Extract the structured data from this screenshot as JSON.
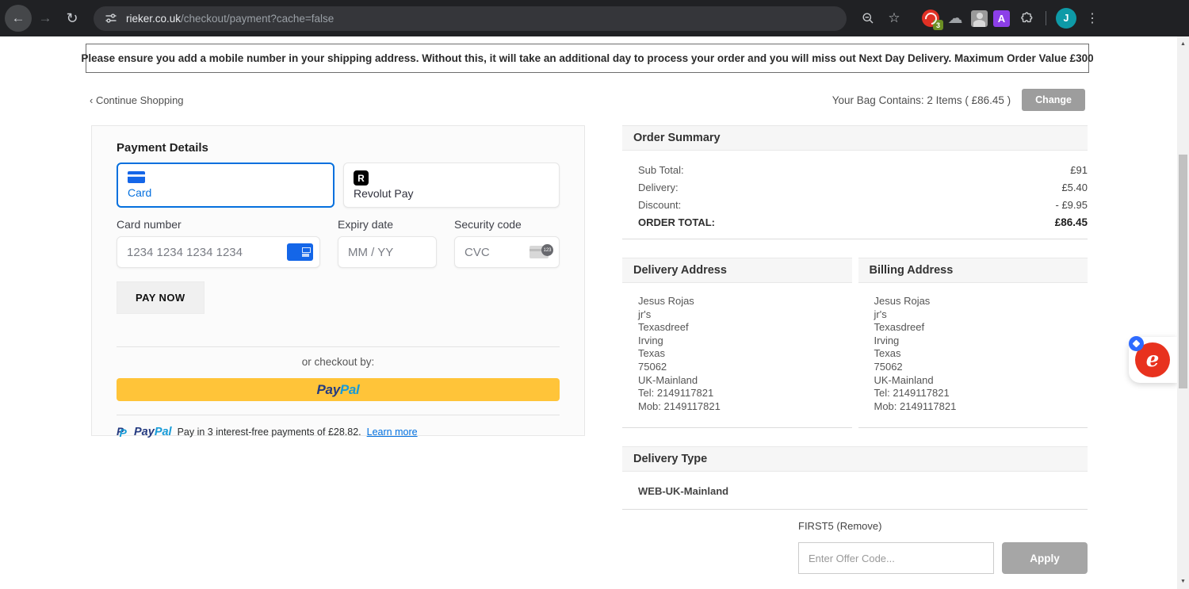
{
  "browser": {
    "url_domain": "rieker.co.uk",
    "url_path": "/checkout/payment?cache=false",
    "avatar_letter": "J",
    "ext_badge": "3",
    "ext_a_letter": "A"
  },
  "icons": {
    "back": "←",
    "forward": "→",
    "reload": "↻",
    "star": "☆",
    "overflow": "⋮",
    "cloud": "☁",
    "scroll_up": "▲",
    "scroll_down": "▼",
    "revolut": "R",
    "cvc_digits": "123",
    "monogram_p": "P",
    "coupon_logo": "e"
  },
  "banner": {
    "text": "Please ensure you add a mobile number in your shipping address. Without this, it will take an additional day to process your order and you will miss out Next Day Delivery. Maximum Order Value £300"
  },
  "header": {
    "continue_shopping": "‹ Continue Shopping",
    "bag_summary": "Your Bag Contains: 2 Items ( £86.45 )",
    "change_label": "Change"
  },
  "payment": {
    "title": "Payment Details",
    "methods": [
      {
        "label": "Card"
      },
      {
        "label": "Revolut Pay"
      }
    ],
    "card_number_label": "Card number",
    "card_number_placeholder": "1234 1234 1234 1234",
    "expiry_label": "Expiry date",
    "expiry_placeholder": "MM / YY",
    "cvc_label": "Security code",
    "cvc_placeholder": "CVC",
    "pay_now_label": "PAY NOW",
    "or_checkout": "or checkout by:",
    "paypal_pay": "Pay",
    "paypal_pal": "Pal",
    "pay_in_3_text": "Pay in 3 interest-free payments of £28.82.",
    "learn_more": "Learn more"
  },
  "order_summary": {
    "title": "Order Summary",
    "rows": [
      {
        "label": "Sub Total:",
        "value": "£91"
      },
      {
        "label": "Delivery:",
        "value": "£5.40"
      },
      {
        "label": "Discount:",
        "value": "- £9.95"
      },
      {
        "label": "ORDER TOTAL:",
        "value": "£86.45"
      }
    ]
  },
  "delivery_address": {
    "title": "Delivery Address",
    "lines": [
      "Jesus Rojas",
      "jr's",
      "Texasdreef",
      "Irving",
      "Texas",
      "75062",
      "UK-Mainland",
      "Tel: 2149117821",
      "Mob: 2149117821"
    ]
  },
  "billing_address": {
    "title": "Billing Address",
    "lines": [
      "Jesus Rojas",
      "jr's",
      "Texasdreef",
      "Irving",
      "Texas",
      "75062",
      "UK-Mainland",
      "Tel: 2149117821",
      "Mob: 2149117821"
    ]
  },
  "delivery_type": {
    "title": "Delivery Type",
    "value": "WEB-UK-Mainland"
  },
  "offer": {
    "applied": "FIRST5 (Remove)",
    "placeholder": "Enter Offer Code...",
    "apply_label": "Apply"
  },
  "accent_colors": {
    "stripe_blue": "#0570de",
    "paypal_yellow": "#ffc439",
    "paypal_dark_blue": "#253b80",
    "paypal_light_blue": "#179bd7",
    "chrome_bg": "#202124"
  }
}
